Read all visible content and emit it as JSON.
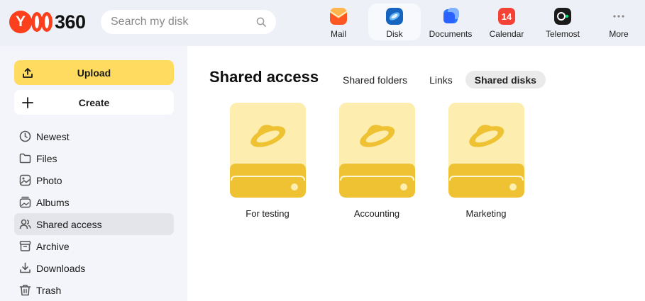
{
  "header": {
    "logo_text": "360",
    "logo_letter": "Y",
    "search": {
      "placeholder": "Search my disk",
      "value": ""
    },
    "apps": [
      {
        "label": "Mail",
        "icon": "mail-icon",
        "active": false
      },
      {
        "label": "Disk",
        "icon": "disk-icon",
        "active": true
      },
      {
        "label": "Documents",
        "icon": "documents-icon",
        "active": false
      },
      {
        "label": "Calendar",
        "icon": "calendar-icon",
        "active": false,
        "badge": "14"
      },
      {
        "label": "Telemost",
        "icon": "telemost-icon",
        "active": false
      },
      {
        "label": "More",
        "icon": "more-icon",
        "active": false
      }
    ]
  },
  "sidebar": {
    "upload_label": "Upload",
    "create_label": "Create",
    "items": [
      {
        "label": "Newest",
        "icon": "clock-icon",
        "active": false
      },
      {
        "label": "Files",
        "icon": "folder-icon",
        "active": false
      },
      {
        "label": "Photo",
        "icon": "photo-icon",
        "active": false
      },
      {
        "label": "Albums",
        "icon": "albums-icon",
        "active": false
      },
      {
        "label": "Shared access",
        "icon": "shared-users-icon",
        "active": true
      },
      {
        "label": "Archive",
        "icon": "archive-icon",
        "active": false
      },
      {
        "label": "Downloads",
        "icon": "download-icon",
        "active": false
      },
      {
        "label": "Trash",
        "icon": "trash-icon",
        "active": false
      }
    ]
  },
  "main": {
    "title": "Shared access",
    "tabs": [
      {
        "label": "Shared folders",
        "active": false
      },
      {
        "label": "Links",
        "active": false
      },
      {
        "label": "Shared disks",
        "active": true
      }
    ],
    "disks": [
      {
        "label": "For testing"
      },
      {
        "label": "Accounting"
      },
      {
        "label": "Marketing"
      }
    ]
  },
  "colors": {
    "accent_yellow": "#ffdc60",
    "disk_light": "#fdeeb0",
    "disk_dark": "#eec232",
    "brand_red": "#fc3f1d"
  }
}
